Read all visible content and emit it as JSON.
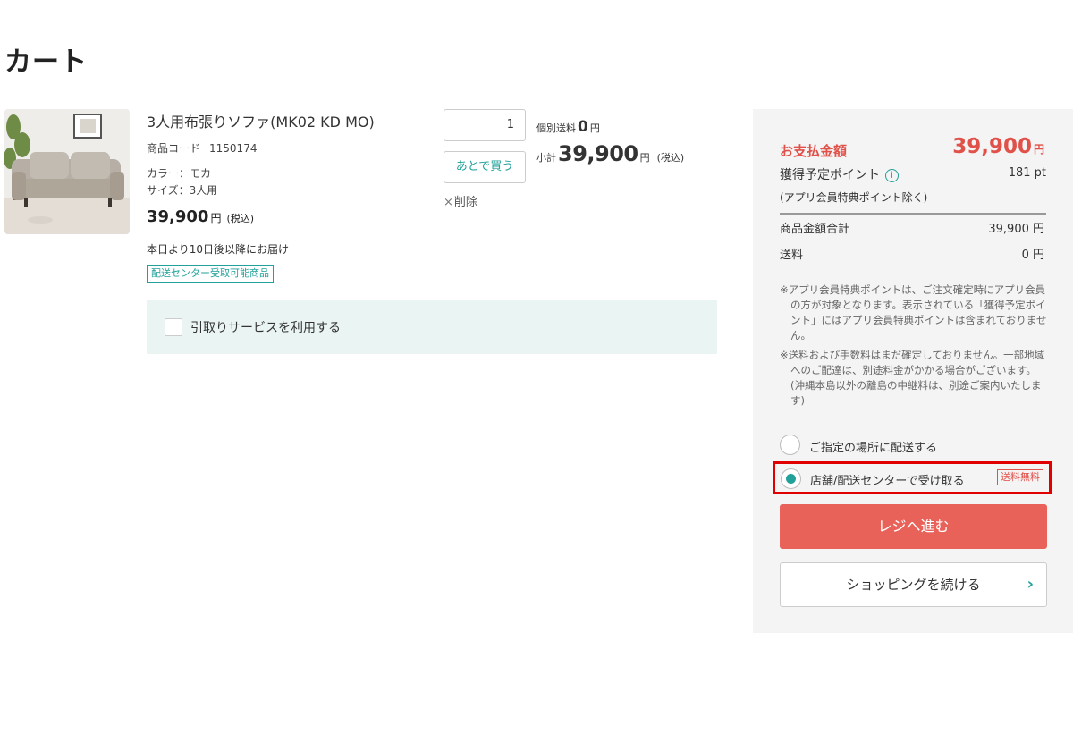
{
  "page": {
    "title": "カート"
  },
  "product": {
    "name": "3人用布張りソファ(MK02 KD MO)",
    "code_label": "商品コード",
    "code": "1150174",
    "color": "カラー：モカ",
    "size": "サイズ：3人用",
    "price": "39,900",
    "price_yen": "円",
    "price_tax": "(税込)",
    "delivery": "本日より10日後以降にお届け",
    "badge": "配送センター受取可能商品",
    "image_icon": "sofa-product-image"
  },
  "item_actions": {
    "quantity": "1",
    "later_button": "あとで買う",
    "delete_label": "削除",
    "delete_icon": "×"
  },
  "item_totals": {
    "shipping_label": "個別送料",
    "shipping_value": "0",
    "shipping_yen": "円",
    "subtotal_label": "小計",
    "subtotal_value": "39,900",
    "subtotal_yen": "円",
    "subtotal_tax": "(税込)"
  },
  "pickup_service": {
    "label": "引取りサービスを利用する"
  },
  "summary": {
    "pay_label": "お支払金額",
    "pay_amount": "39,900",
    "pay_yen": "円",
    "points_label": "獲得予定ポイント",
    "info_icon": "i",
    "points_value": "181 pt",
    "points_note": "(アプリ会員特典ポイント除く)",
    "rows": [
      {
        "label": "商品金額合計",
        "value": "39,900 円"
      },
      {
        "label": "送料",
        "value": "0 円"
      }
    ],
    "notes": [
      "※アプリ会員特典ポイントは、ご注文確定時にアプリ会員の方が対象となります。表示されている「獲得予定ポイント」にはアプリ会員特典ポイントは含まれておりません。",
      "※送料および手数料はまだ確定しておりません。一部地域へのご配達は、別途料金がかかる場合がございます。(沖縄本島以外の離島の中継料は、別途ご案内いたします)"
    ],
    "delivery_options": [
      {
        "label": "ご指定の場所に配送する",
        "selected": false
      },
      {
        "label": "店舗/配送センターで受け取る",
        "selected": true,
        "badge": "送料無料"
      }
    ],
    "checkout_button": "レジへ進む",
    "continue_button": "ショッピングを続ける",
    "continue_icon": "›"
  },
  "colors": {
    "accent_red": "#e0514a",
    "checkout_bg": "#e9625a",
    "teal": "#21a19a",
    "highlight_border": "#e00000",
    "sidebar_bg": "#f4f4f4",
    "pickup_bg": "#eaf4f3"
  }
}
